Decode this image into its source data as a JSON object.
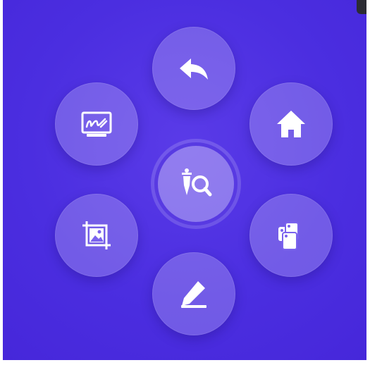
{
  "menu": {
    "items": [
      {
        "name": "back",
        "icon": "undo-arrow-icon"
      },
      {
        "name": "home",
        "icon": "home-icon"
      },
      {
        "name": "pages",
        "icon": "stacked-pages-icon"
      },
      {
        "name": "annotate",
        "icon": "pen-icon"
      },
      {
        "name": "crop-image",
        "icon": "crop-image-icon"
      },
      {
        "name": "whiteboard",
        "icon": "whiteboard-scribble-icon"
      }
    ],
    "center": {
      "name": "inspect",
      "icon": "magnifier-tool-icon"
    }
  },
  "colors": {
    "background": "#4b2ee0",
    "button_fill": "#7b63ee",
    "icon": "#ffffff"
  }
}
